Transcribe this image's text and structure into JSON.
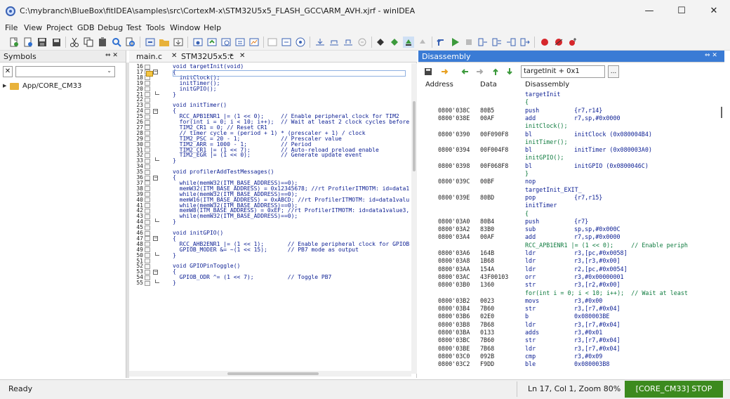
{
  "window": {
    "title": "C:\\mybranch\\BlueBox\\fitIDEA\\samples\\src\\CortexM-x\\STM32U5x5_FLASH_GCC\\ARM_AVH.xjrf - winIDEA",
    "controls": [
      "—",
      "☐",
      "✕"
    ]
  },
  "menu": [
    "File",
    "View",
    "Project",
    "GDB",
    "Debug",
    "Test",
    "Tools",
    "Window",
    "Help"
  ],
  "symbols": {
    "title": "Symbols",
    "pin": "⇔ ✕",
    "filter_value": "",
    "tree_item": "App/CORE_CM33"
  },
  "editor": {
    "tabs": [
      {
        "label": "main.c",
        "active": false
      },
      {
        "label": "STM32U5x5.c",
        "active": true
      }
    ],
    "lines": [
      {
        "n": "16",
        "t": "void targetInit(void)"
      },
      {
        "n": "17",
        "t": "{"
      },
      {
        "n": "18",
        "t": "  initClock();"
      },
      {
        "n": "19",
        "t": "  initTimer();"
      },
      {
        "n": "20",
        "t": "  initGPIO();"
      },
      {
        "n": "21",
        "t": "}"
      },
      {
        "n": "22",
        "t": ""
      },
      {
        "n": "23",
        "t": "void initTimer()"
      },
      {
        "n": "24",
        "t": "{"
      },
      {
        "n": "25",
        "t": "  RCC_APB1ENR1 |= (1 << 0);     // Enable peripheral clock for TIM2"
      },
      {
        "n": "26",
        "t": "  for(int i = 0; i < 10; i++);  // Wait at least 2 clock cycles before"
      },
      {
        "n": "27",
        "t": "  TIM2_CR1 = 0; // Reset CR1"
      },
      {
        "n": "28",
        "t": "  // timer cycle = (period + 1) * (prescaler + 1) / clock"
      },
      {
        "n": "29",
        "t": "  TIM2_PSC = 20 - 1;            // Prescaler value"
      },
      {
        "n": "30",
        "t": "  TIM2_ARR = 1000 - 1;          // Period"
      },
      {
        "n": "31",
        "t": "  TIM2_CR1 |= (1 << 7);         // Auto-reload preload enable"
      },
      {
        "n": "32",
        "t": "  TIM2_EGR |= (1 << 0);         // Generate update event"
      },
      {
        "n": "33",
        "t": "}"
      },
      {
        "n": "34",
        "t": ""
      },
      {
        "n": "35",
        "t": "void profilerAddTestMessages()"
      },
      {
        "n": "36",
        "t": "{"
      },
      {
        "n": "37",
        "t": "  while(memW32(ITM_BASE_ADDRESS)==0);"
      },
      {
        "n": "38",
        "t": "  memW32(ITM_BASE_ADDRESS) = 0x12345678; //rt ProfilerITMOTM: id=data1"
      },
      {
        "n": "39",
        "t": "  while(memW32(ITM_BASE_ADDRESS)==0);"
      },
      {
        "n": "40",
        "t": "  memW16(ITM_BASE_ADDRESS) = 0xABCD; //rt ProfilerITMOTM: id=data1valu"
      },
      {
        "n": "41",
        "t": "  while(memW32(ITM_BASE_ADDRESS)==0);"
      },
      {
        "n": "42",
        "t": "  memW8(ITM_BASE_ADDRESS) = 0xEF; //rt ProfilerITMOTM: id=data1value3,"
      },
      {
        "n": "43",
        "t": "  while(memW32(ITM_BASE_ADDRESS)==0);"
      },
      {
        "n": "44",
        "t": "}"
      },
      {
        "n": "45",
        "t": ""
      },
      {
        "n": "46",
        "t": "void initGPIO()"
      },
      {
        "n": "47",
        "t": "{"
      },
      {
        "n": "48",
        "t": "  RCC_AHB2ENR1 |= (1 << 1);       // Enable peripheral clock for GPIOB"
      },
      {
        "n": "49",
        "t": "  GPIOB_MODER &= ~(1 << 15);      // PB7 mode as output"
      },
      {
        "n": "50",
        "t": "}"
      },
      {
        "n": "51",
        "t": ""
      },
      {
        "n": "52",
        "t": "void GPIOPinToggle()"
      },
      {
        "n": "53",
        "t": "{"
      },
      {
        "n": "54",
        "t": "  GPIOB_ODR ^= (1 << 7);          // Toggle PB7"
      },
      {
        "n": "55",
        "t": "}"
      }
    ]
  },
  "disassembly": {
    "title": "Disassembly",
    "pin": "⇔ ✕",
    "location": "targetInit + 0x1",
    "more": "...",
    "columns": [
      "Address",
      "Data",
      "Disassembly"
    ],
    "rows": [
      {
        "k": "lbl",
        "text": "targetInit"
      },
      {
        "k": "src",
        "text": "{"
      },
      {
        "k": "ins",
        "addr": "0800'038C",
        "data": "80B5",
        "mn": "push",
        "op": "{r7,r14}"
      },
      {
        "k": "ins",
        "addr": "0800'038E",
        "data": "00AF",
        "mn": "add",
        "op": "r7,sp,#0x0000"
      },
      {
        "k": "src",
        "text": "initClock();"
      },
      {
        "k": "ins",
        "addr": "0800'0390",
        "data": "00F090F8",
        "mn": "bl",
        "op": "initClock (0x080004B4)"
      },
      {
        "k": "src",
        "text": "initTimer();"
      },
      {
        "k": "ins",
        "addr": "0800'0394",
        "data": "00F004F8",
        "mn": "bl",
        "op": "initTimer (0x080003A0)"
      },
      {
        "k": "src",
        "text": "initGPIO();"
      },
      {
        "k": "ins",
        "addr": "0800'0398",
        "data": "00F068F8",
        "mn": "bl",
        "op": "initGPIO (0x0800046C)"
      },
      {
        "k": "src",
        "text": "}"
      },
      {
        "k": "ins",
        "addr": "0800'039C",
        "data": "00BF",
        "mn": "nop",
        "op": ""
      },
      {
        "k": "lbl",
        "text": "targetInit_EXIT_"
      },
      {
        "k": "ins",
        "addr": "0800'039E",
        "data": "80BD",
        "mn": "pop",
        "op": "{r7,r15}"
      },
      {
        "k": "lbl",
        "text": "initTimer"
      },
      {
        "k": "src",
        "text": "{"
      },
      {
        "k": "ins",
        "addr": "0800'03A0",
        "data": "80B4",
        "mn": "push",
        "op": "{r7}"
      },
      {
        "k": "ins",
        "addr": "0800'03A2",
        "data": "83B0",
        "mn": "sub",
        "op": "sp,sp,#0x000C"
      },
      {
        "k": "ins",
        "addr": "0800'03A4",
        "data": "00AF",
        "mn": "add",
        "op": "r7,sp,#0x0000"
      },
      {
        "k": "src",
        "text": "RCC_APB1ENR1 |= (1 << 0);     // Enable periph"
      },
      {
        "k": "ins",
        "addr": "0800'03A6",
        "data": "164B",
        "mn": "ldr",
        "op": "r3,[pc,#0x0058]"
      },
      {
        "k": "ins",
        "addr": "0800'03A8",
        "data": "1B68",
        "mn": "ldr",
        "op": "r3,[r3,#0x00]"
      },
      {
        "k": "ins",
        "addr": "0800'03AA",
        "data": "154A",
        "mn": "ldr",
        "op": "r2,[pc,#0x0054]"
      },
      {
        "k": "ins",
        "addr": "0800'03AC",
        "data": "43F00103",
        "mn": "orr",
        "op": "r3,#0x00000001"
      },
      {
        "k": "ins",
        "addr": "0800'03B0",
        "data": "1360",
        "mn": "str",
        "op": "r3,[r2,#0x00]"
      },
      {
        "k": "src",
        "text": "for(int i = 0; i < 10; i++);  // Wait at least"
      },
      {
        "k": "ins",
        "addr": "0800'03B2",
        "data": "0023",
        "mn": "movs",
        "op": "r3,#0x00"
      },
      {
        "k": "ins",
        "addr": "0800'03B4",
        "data": "7B60",
        "mn": "str",
        "op": "r3,[r7,#0x04]"
      },
      {
        "k": "ins",
        "addr": "0800'03B6",
        "data": "02E0",
        "mn": "b",
        "op": "0x080003BE"
      },
      {
        "k": "ins",
        "addr": "0800'03B8",
        "data": "7B68",
        "mn": "ldr",
        "op": "r3,[r7,#0x04]"
      },
      {
        "k": "ins",
        "addr": "0800'03BA",
        "data": "0133",
        "mn": "adds",
        "op": "r3,#0x01"
      },
      {
        "k": "ins",
        "addr": "0800'03BC",
        "data": "7B60",
        "mn": "str",
        "op": "r3,[r7,#0x04]"
      },
      {
        "k": "ins",
        "addr": "0800'03BE",
        "data": "7B68",
        "mn": "ldr",
        "op": "r3,[r7,#0x04]"
      },
      {
        "k": "ins",
        "addr": "0800'03C0",
        "data": "092B",
        "mn": "cmp",
        "op": "r3,#0x09"
      },
      {
        "k": "ins",
        "addr": "0800'03C2",
        "data": "F9DD",
        "mn": "ble",
        "op": "0x080003B8"
      }
    ]
  },
  "status": {
    "left": "Ready",
    "position": "Ln 17, Col 1, Zoom 80%",
    "core_state": "[CORE_CM33] STOP",
    "core_color": "#3c8a1e"
  }
}
